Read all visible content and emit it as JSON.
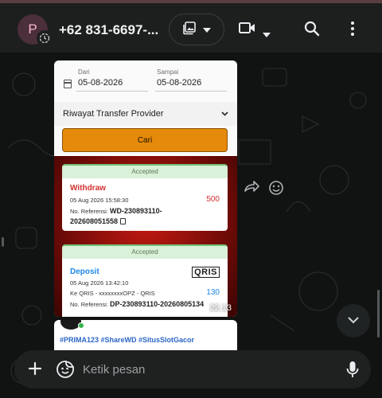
{
  "header": {
    "avatar_letter": "P",
    "contact_name": "+62 831-6697-..."
  },
  "message": {
    "form": {
      "from_label": "Dari",
      "from_value": "05-08-2026",
      "to_label": "Sampai",
      "to_value": "05-08-2026",
      "provider_label": "Riwayat Transfer Provider",
      "search_button": "Cari"
    },
    "transactions": [
      {
        "status": "Accepted",
        "type": "Withdraw",
        "type_color": "#d32f2f",
        "datetime": "05 Aug 2026 15:58:30",
        "amount": "500",
        "amount_color": "#d32f2f",
        "ref_label": "No. Referensi:",
        "ref_part1": "WD-230893110-",
        "ref_part2": "202608051558"
      },
      {
        "status": "Accepted",
        "type": "Deposit",
        "type_color": "#1e88e5",
        "datetime": "05 Aug 2026 13:42:10",
        "amount": "130",
        "amount_color": "#1e88e5",
        "detail": "Ke QRIS - xxxxxxxxOPZ - QRIS",
        "ref_label": "No. Referensi:",
        "ref_value": "DP-230893110-20260805134",
        "logo": "QRIS"
      }
    ],
    "time": "22.13"
  },
  "second_message": {
    "hashtags": "#PRIMA123 #ShareWD #SitusSlotGacor"
  },
  "composer": {
    "placeholder": "Ketik pesan"
  },
  "colors": {
    "header_bg": "#1d1f1f",
    "chat_bg": "#111313",
    "accent_orange": "#e58a0b",
    "accepted_green": "#d9f0d9"
  },
  "icons": [
    "status-ring-icon",
    "gallery-icon",
    "chevron-down-icon",
    "video-call-icon",
    "search-icon",
    "more-vert-icon",
    "forward-icon",
    "emoji-icon",
    "plus-icon",
    "sticker-icon",
    "mic-icon",
    "calendar-icon",
    "copy-icon"
  ]
}
